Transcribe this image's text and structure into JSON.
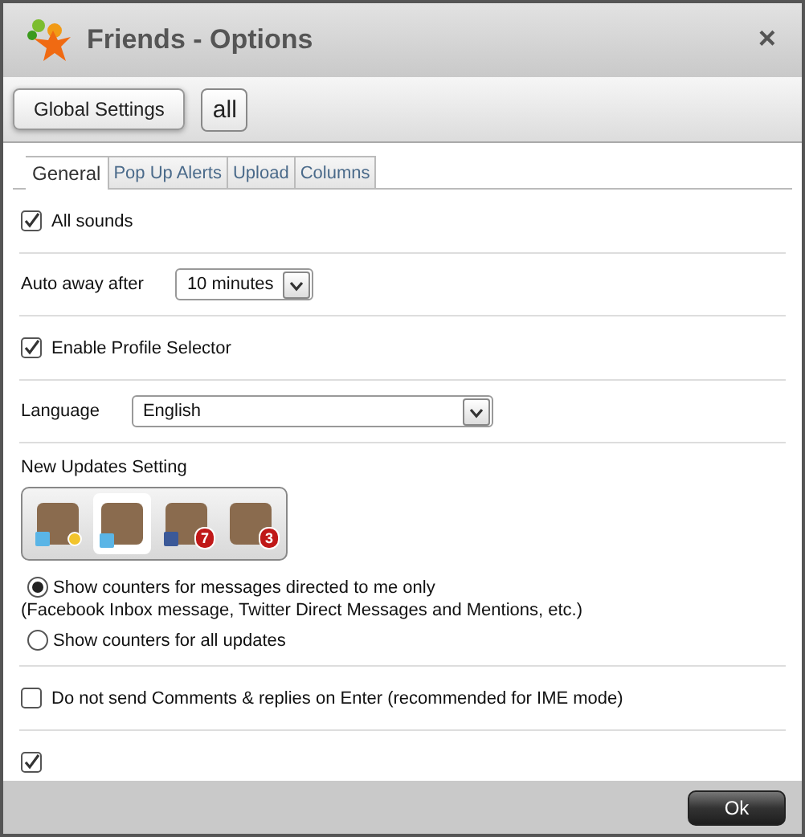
{
  "window": {
    "title": "Friends - Options",
    "close": "×"
  },
  "toolbar": {
    "buttons": [
      {
        "label": "Global Settings",
        "selected": true
      },
      {
        "label": "all",
        "selected": false
      }
    ]
  },
  "tabs": [
    {
      "label": "General",
      "selected": true
    },
    {
      "label": "Pop Up Alerts",
      "selected": false
    },
    {
      "label": "Upload",
      "selected": false
    },
    {
      "label": "Columns",
      "selected": false
    }
  ],
  "settings": [
    {
      "kind": "checkbox",
      "label": "All sounds",
      "checked": true
    },
    {
      "kind": "picker",
      "label": "Auto away after",
      "value": "10 minutes"
    },
    {
      "kind": "checkbox",
      "label": "Enable Profile Selector",
      "checked": true
    },
    {
      "kind": "dropdown",
      "label": "Language",
      "value": "English"
    },
    {
      "kind": "updates",
      "label": "New Updates Setting",
      "avatars": [
        {
          "selected": false,
          "away": true
        },
        {
          "selected": true
        },
        {
          "selected": false,
          "badge": "7"
        },
        {
          "selected": false,
          "badge": "3"
        }
      ],
      "options": [
        {
          "label": "Show counters for messages directed to me only",
          "note": "(Facebook Inbox message, Twitter Direct Messages and Mentions, etc.)",
          "selected": true
        },
        {
          "label": "Show counters for all updates",
          "selected": false
        }
      ]
    },
    {
      "kind": "checkbox",
      "label": "Do not send Comments & replies on Enter (recommended for IME mode)",
      "checked": false
    },
    {
      "kind": "checkbox",
      "checked": true
    }
  ],
  "footer": {
    "button": "Ok"
  }
}
